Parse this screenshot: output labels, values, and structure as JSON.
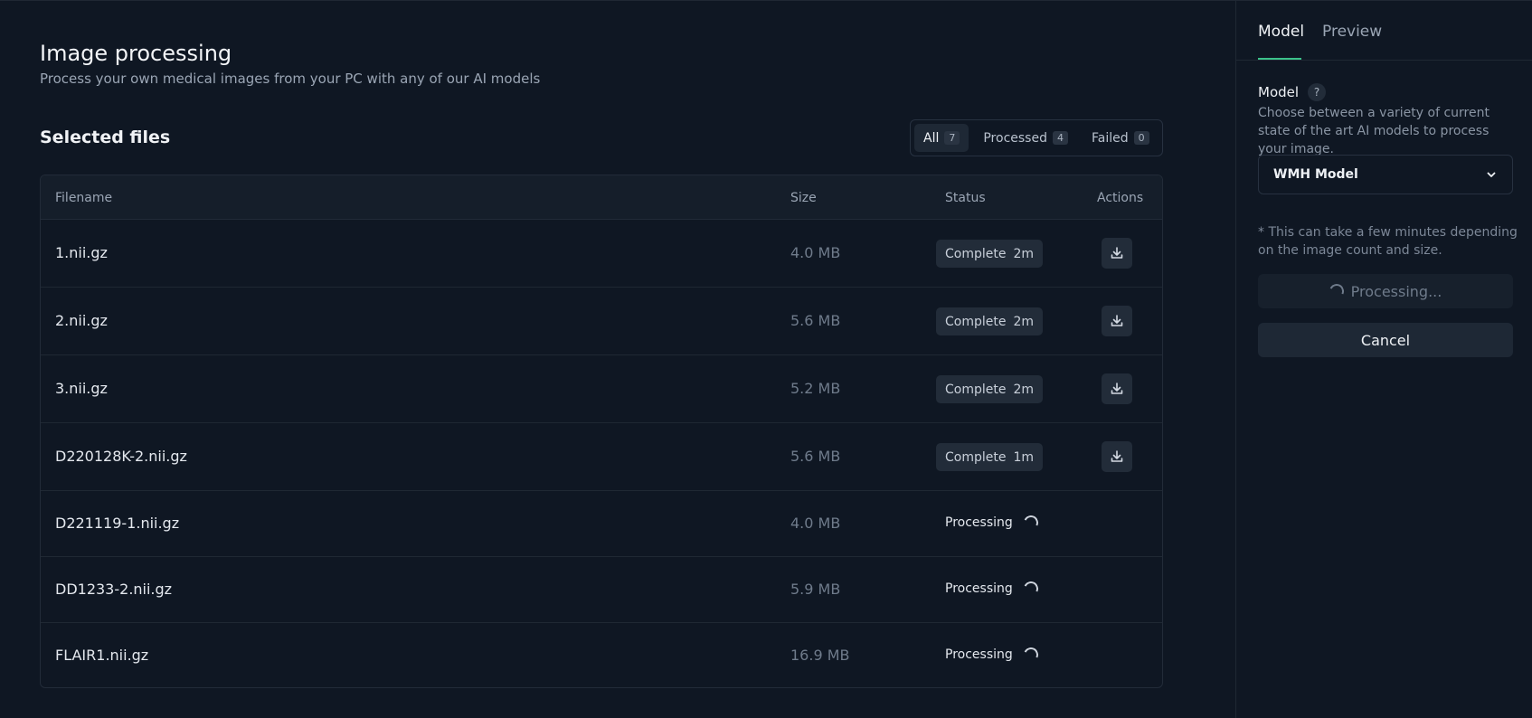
{
  "header": {
    "title": "Image processing",
    "subtitle": "Process your own medical images from your PC with any of our AI models"
  },
  "files_section": {
    "title": "Selected files",
    "filters": [
      {
        "label": "All",
        "count": "7",
        "active": true
      },
      {
        "label": "Processed",
        "count": "4",
        "active": false
      },
      {
        "label": "Failed",
        "count": "0",
        "active": false
      }
    ]
  },
  "table": {
    "columns": {
      "filename": "Filename",
      "size": "Size",
      "status": "Status",
      "actions": "Actions"
    },
    "rows": [
      {
        "filename": "1.nii.gz",
        "size": "4.0 MB",
        "status": "Complete",
        "time": "2m",
        "state": "complete"
      },
      {
        "filename": "2.nii.gz",
        "size": "5.6 MB",
        "status": "Complete",
        "time": "2m",
        "state": "complete"
      },
      {
        "filename": "3.nii.gz",
        "size": "5.2 MB",
        "status": "Complete",
        "time": "2m",
        "state": "complete"
      },
      {
        "filename": "D220128K-2.nii.gz",
        "size": "5.6 MB",
        "status": "Complete",
        "time": "1m",
        "state": "complete"
      },
      {
        "filename": "D221119-1.nii.gz",
        "size": "4.0 MB",
        "status": "Processing",
        "time": "",
        "state": "processing"
      },
      {
        "filename": "DD1233-2.nii.gz",
        "size": "5.9 MB",
        "status": "Processing",
        "time": "",
        "state": "processing"
      },
      {
        "filename": "FLAIR1.nii.gz",
        "size": "16.9 MB",
        "status": "Processing",
        "time": "",
        "state": "processing"
      }
    ]
  },
  "panel": {
    "tabs": [
      {
        "label": "Model",
        "active": true
      },
      {
        "label": "Preview",
        "active": false
      }
    ],
    "model_label": "Model",
    "help_glyph": "?",
    "model_description": "Choose between a variety of current state of the art AI models to process your image.",
    "selected_model": "WMH Model",
    "note": "* This can take a few minutes depending on the image count and size.",
    "processing_label": "Processing...",
    "cancel_label": "Cancel"
  },
  "colors": {
    "background": "#0f1723",
    "accent": "#3cc28a"
  },
  "icons": {
    "download": "download-icon",
    "spinner": "spinner-icon",
    "chevron": "chevron-down-icon",
    "help": "help-icon"
  }
}
